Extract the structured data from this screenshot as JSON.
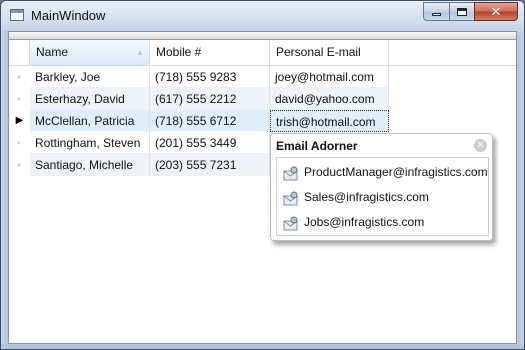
{
  "window": {
    "title": "MainWindow",
    "caption_buttons": {
      "minimize_icon": "minimize-icon",
      "maximize_icon": "maximize-icon",
      "close_icon": "close-icon",
      "close_glyph": "✕"
    }
  },
  "grid": {
    "columns": [
      "Name",
      "Mobile #",
      "Personal E-mail"
    ],
    "current_row_glyph": "▶",
    "inactive_row_glyph": "▸",
    "rows": [
      {
        "name": "Barkley, Joe",
        "mobile": "(718) 555 9283",
        "email": "joey@hotmail.com"
      },
      {
        "name": "Esterhazy, David",
        "mobile": "(617) 555 2212",
        "email": "david@yahoo.com"
      },
      {
        "name": "McClellan, Patricia",
        "mobile": "(718) 555 6712",
        "email": "trish@hotmail.com"
      },
      {
        "name": "Rottingham, Steven",
        "mobile": "(201) 555 3449",
        "email": ""
      },
      {
        "name": "Santiago, Michelle",
        "mobile": "(203) 555 7231",
        "email": ""
      }
    ],
    "selected_row_index": 2
  },
  "adorner": {
    "title": "Email Adorner",
    "close_glyph": "✕",
    "items": [
      {
        "label": "ProductManager@infragistics.com",
        "icon": "contact-icon"
      },
      {
        "label": "Sales@infragistics.com",
        "icon": "contact-icon"
      },
      {
        "label": "Jobs@infragistics.com",
        "icon": "contact-icon"
      }
    ]
  },
  "colors": {
    "selection_row": "#e0eef9",
    "alt_row": "#eef3f8",
    "header_selected": "#dcebf8",
    "window_border": "#3d4f66"
  }
}
